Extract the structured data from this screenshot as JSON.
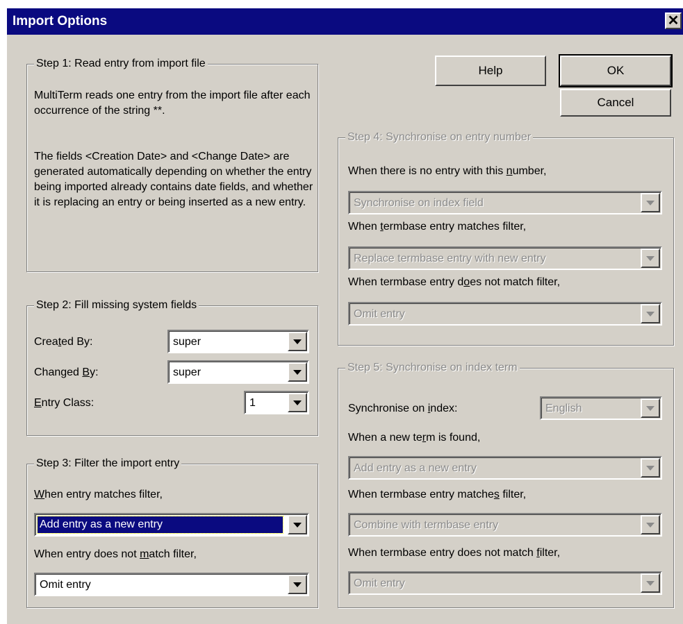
{
  "window": {
    "title": "Import Options",
    "close_glyph": "✕"
  },
  "buttons": {
    "help": "Help",
    "ok": "OK",
    "cancel": "Cancel"
  },
  "step1": {
    "legend": "Step 1:  Read entry from import file",
    "para1": "MultiTerm reads one entry from the import file after each occurrence of the string **.",
    "para2": "The fields <Creation Date> and <Change Date> are generated automatically depending on whether the entry being imported already contains date fields, and whether it is replacing an entry or being inserted as a new entry."
  },
  "step2": {
    "legend": "Step 2:  Fill missing system fields",
    "created_by_label": "Created By:",
    "created_by_value": "super",
    "changed_by_label": "Changed By:",
    "changed_by_value": "super",
    "entry_class_label": "Entry Class:",
    "entry_class_value": "1"
  },
  "step3": {
    "legend": "Step 3:  Filter the import entry",
    "match_label": "When entry matches filter,",
    "match_value": "Add entry as a new entry",
    "nomatch_label": "When entry does not match filter,",
    "nomatch_value": "Omit entry"
  },
  "step4": {
    "legend": "Step 4:  Synchronise on entry number",
    "no_entry_label": "When there is no entry with this number,",
    "no_entry_value": "Synchronise on index field",
    "match_label": "When termbase entry matches filter,",
    "match_value": "Replace termbase entry with new entry",
    "nomatch_label": "When termbase entry does not match filter,",
    "nomatch_value": "Omit entry"
  },
  "step5": {
    "legend": "Step 5:  Synchronise on index term",
    "index_label": "Synchronise on index:",
    "index_value": "English",
    "new_term_label": "When a new term is found,",
    "new_term_value": "Add entry as a new entry",
    "match_label": "When termbase entry matches filter,",
    "match_value": "Combine with termbase entry",
    "nomatch_label": "When termbase entry does not match filter,",
    "nomatch_value": "Omit entry"
  },
  "icons": {
    "close": "close-icon",
    "dropdown": "chevron-down-icon"
  },
  "colors": {
    "titlebar": "#0a0a80",
    "face": "#d4d0c8",
    "disabled_text": "#8a8a8a"
  }
}
